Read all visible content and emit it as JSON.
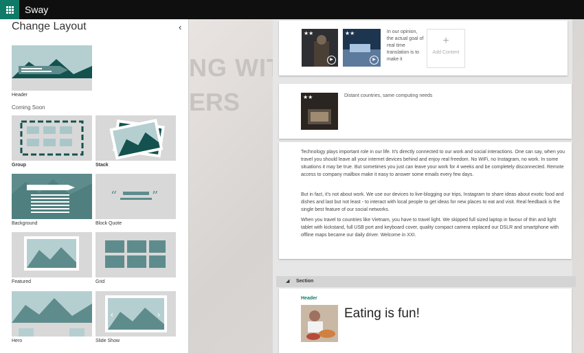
{
  "app": {
    "name": "Sway",
    "launcher_icon": "app-launcher-grid-icon"
  },
  "pane": {
    "title": "Change Layout",
    "collapse_icon": "chevron-left-icon",
    "current_label": "Header",
    "coming_soon": "Coming Soon",
    "layouts": [
      {
        "label": "Group"
      },
      {
        "label": "Stack"
      },
      {
        "label": "Background"
      },
      {
        "label": "Block Quote"
      },
      {
        "label": "Featured"
      },
      {
        "label": "Grid"
      },
      {
        "label": "Hero"
      },
      {
        "label": "Slide Show"
      }
    ]
  },
  "canvas": {
    "ghost_line1": "NG WIT",
    "ghost_line2": "ERS",
    "card1": {
      "text": "In our opinion, the actual goal of real time translation is to make it",
      "add_content": "Add Content"
    },
    "card2": {
      "caption": "Distant countries, same computing needs"
    },
    "card3": {
      "p1": "Technology plays important role in our life. It's directly connected to our work and social interactions. One can say, when you travel you should leave all your internet devices behind and enjoy real freedom. No WiFi, no Instagram, no work. In some situations it may be true. But sometimes you just can leave your work for 4 weeks and be completely disconnected. Remote access to company mailbox make it easy to answer some emails every few days.",
      "p2": "But in fact, it's not about work. We use our devices to live-blogging our trips, Instagram to share ideas about exotic food and dishes and last but not least - to interact with local people to get ideas for new places to eat and visit. Real feedback is the single best feature of our social networks.",
      "p3": "When you travel to countries like Vietnam, you have to travel light. We skipped full sized laptop in favour of thin and light tablet with kickstand, full USB port and keyboard cover, quality compact camera replaced our DSLR and smartphone with offline maps became our daily driver. Welcome in XXI."
    },
    "section": {
      "label": "Section",
      "header_label": "Header",
      "heading": "Eating is fun!"
    }
  },
  "colors": {
    "accent": "#0f7a68",
    "tile_teal": "#5e8c8c",
    "tile_dark": "#14524f"
  }
}
